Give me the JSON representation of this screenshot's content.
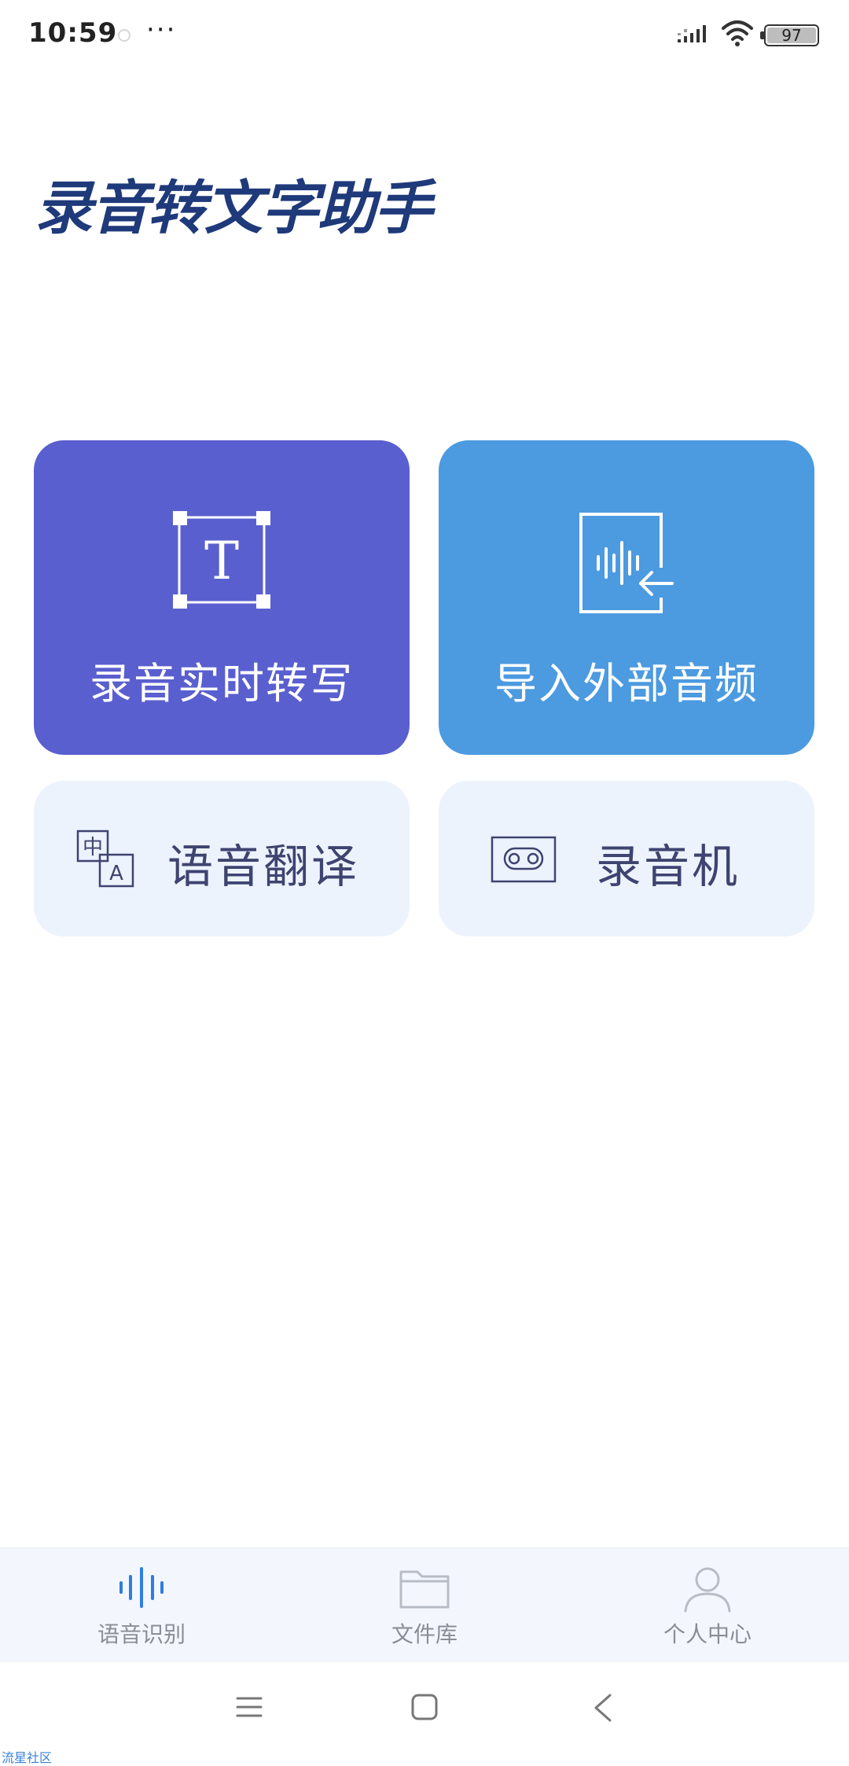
{
  "status_bar": {
    "time": "10:59",
    "dots": "···",
    "battery": "97"
  },
  "app": {
    "title": "录音转文字助手"
  },
  "cards": {
    "transcribe": {
      "label": "录音实时转写",
      "icon": "text-frame-icon",
      "color": "#5a5fcf"
    },
    "import": {
      "label": "导入外部音频",
      "icon": "audio-file-import-icon",
      "color": "#4c9ae0"
    },
    "translate": {
      "label": "语音翻译",
      "icon": "translate-icon"
    },
    "recorder": {
      "label": "录音机",
      "icon": "cassette-icon"
    }
  },
  "bottom_nav": {
    "items": [
      {
        "label": "语音识别",
        "icon": "waveform-icon",
        "active": true
      },
      {
        "label": "文件库",
        "icon": "folder-icon",
        "active": false
      },
      {
        "label": "个人中心",
        "icon": "user-icon",
        "active": false
      }
    ]
  },
  "watermark": "流星社区"
}
